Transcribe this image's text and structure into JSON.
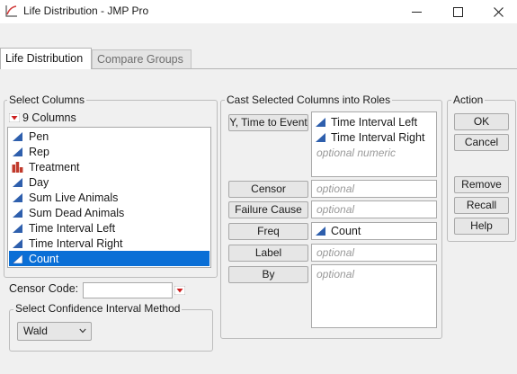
{
  "window": {
    "title": "Life Distribution - JMP Pro"
  },
  "tabs": [
    {
      "label": "Life Distribution",
      "active": true
    },
    {
      "label": "Compare Groups",
      "active": false
    }
  ],
  "select_columns": {
    "title": "Select Columns",
    "count_label": "9 Columns",
    "columns": [
      {
        "name": "Pen",
        "icon": "continuous-icon",
        "selected": false
      },
      {
        "name": "Rep",
        "icon": "continuous-icon",
        "selected": false
      },
      {
        "name": "Treatment",
        "icon": "nominal-icon",
        "selected": false
      },
      {
        "name": "Day",
        "icon": "continuous-icon",
        "selected": false
      },
      {
        "name": "Sum Live Animals",
        "icon": "continuous-icon",
        "selected": false
      },
      {
        "name": "Sum Dead Animals",
        "icon": "continuous-icon",
        "selected": false
      },
      {
        "name": "Time Interval Left",
        "icon": "continuous-icon",
        "selected": false
      },
      {
        "name": "Time Interval Right",
        "icon": "continuous-icon",
        "selected": false
      },
      {
        "name": "Count",
        "icon": "continuous-icon",
        "selected": true
      }
    ]
  },
  "cast_roles": {
    "title": "Cast Selected Columns into Roles",
    "roles": [
      {
        "button": "Y, Time to Event",
        "items": [
          "Time Interval Left",
          "Time Interval Right"
        ],
        "placeholder": "optional numeric"
      },
      {
        "button": "Censor",
        "items": [],
        "placeholder": "optional"
      },
      {
        "button": "Failure Cause",
        "items": [],
        "placeholder": "optional"
      },
      {
        "button": "Freq",
        "items": [
          "Count"
        ],
        "placeholder": ""
      },
      {
        "button": "Label",
        "items": [],
        "placeholder": "optional"
      },
      {
        "button": "By",
        "items": [],
        "placeholder": "optional"
      }
    ]
  },
  "action": {
    "title": "Action",
    "buttons": [
      "OK",
      "Cancel",
      "Remove",
      "Recall",
      "Help"
    ]
  },
  "censor_code": {
    "label": "Censor Code:",
    "value": ""
  },
  "confidence_interval": {
    "title": "Select Confidence Interval Method",
    "selected": "Wald"
  },
  "colors": {
    "selection": "#0a6fd6",
    "continuous_icon": "#2e5fad",
    "nominal_icon": "#c0392b",
    "dropdown_red": "#cc1f1f"
  }
}
